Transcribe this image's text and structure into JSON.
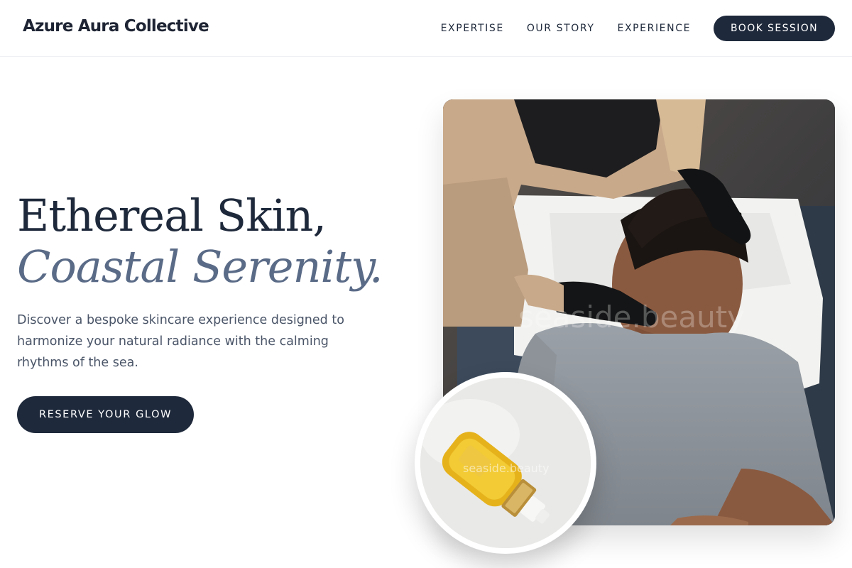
{
  "brand": {
    "name": "Azure Aura Collective"
  },
  "nav": {
    "links": [
      "EXPERTISE",
      "OUR STORY",
      "EXPERIENCE"
    ],
    "book_label": "BOOK SESSION"
  },
  "hero": {
    "title_line1": "Ethereal Skin,",
    "title_line2": "Coastal Serenity.",
    "subtitle": "Discover a bespoke skincare experience designed to harmonize your natural radiance with the calming rhythms of the sea.",
    "cta_label": "RESERVE YOUR GLOW"
  },
  "images": {
    "main_watermark": "seaside.beauty",
    "product_watermark": "seaside.beauty"
  },
  "colors": {
    "primary_dark": "#1e293b",
    "accent_slate": "#5a6b87",
    "body_text": "#4a5568"
  }
}
